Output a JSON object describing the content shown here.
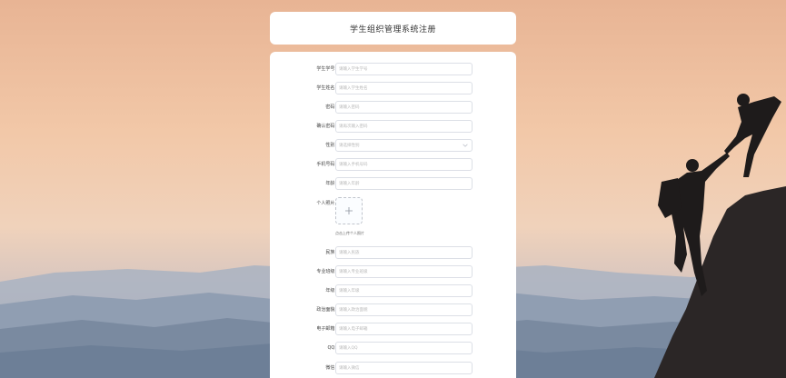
{
  "header": {
    "title": "学生组织管理系统注册"
  },
  "form": {
    "fields": [
      {
        "label": "学生学号:",
        "placeholder": "请输入学生学号"
      },
      {
        "label": "学生姓名:",
        "placeholder": "请输入学生姓名"
      },
      {
        "label": "密码:",
        "placeholder": "请输入密码"
      },
      {
        "label": "确认密码:",
        "placeholder": "请再次输入密码"
      },
      {
        "label": "性别:",
        "placeholder": "请选择性别"
      },
      {
        "label": "手机号码:",
        "placeholder": "请输入手机号码"
      },
      {
        "label": "年龄:",
        "placeholder": "请输入年龄"
      }
    ],
    "photo": {
      "label": "个人照片:",
      "tip": "点击上传个人照片"
    },
    "fields2": [
      {
        "label": "民族:",
        "placeholder": "请输入民族"
      },
      {
        "label": "专业班级:",
        "placeholder": "请输入专业班级"
      },
      {
        "label": "年级:",
        "placeholder": "请输入年级"
      },
      {
        "label": "政治面貌:",
        "placeholder": "请输入政治面貌"
      },
      {
        "label": "电子邮箱:",
        "placeholder": "请输入电子邮箱"
      },
      {
        "label": "QQ:",
        "placeholder": "请输入QQ"
      },
      {
        "label": "微信:",
        "placeholder": "请输入微信"
      }
    ]
  },
  "icons": {
    "select_arrow": "chevron-down-icon",
    "upload": "plus-icon"
  },
  "colors": {
    "sky_top": "#e9b797",
    "mountain": "#7e8ea3",
    "card": "#ffffff",
    "input_border": "#dcdfe6"
  }
}
